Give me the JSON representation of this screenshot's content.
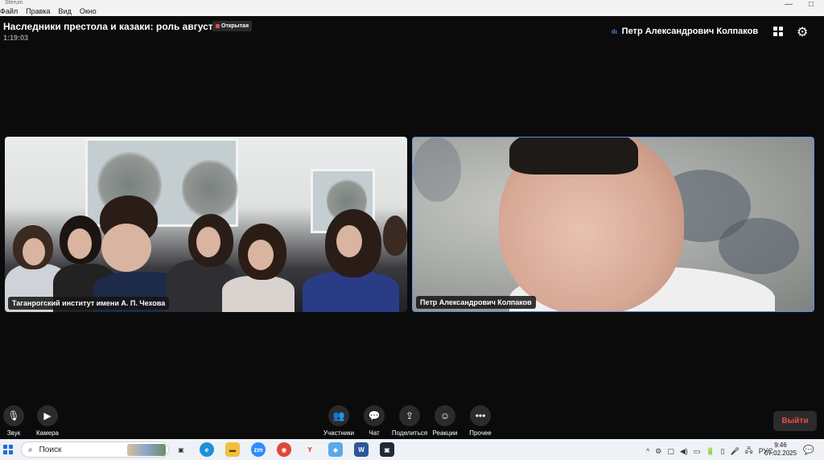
{
  "titlebar": {
    "app_title": "Sferum",
    "menu": [
      "Файл",
      "Правка",
      "Вид",
      "Окно"
    ],
    "minimize_glyph": "—",
    "maximize_glyph": "□"
  },
  "header": {
    "meeting_title": "Наследники престола и казаки: роль августей...",
    "badge": "Открытая",
    "timer": "1:19:03",
    "active_speaker": "Петр Александрович Колпаков",
    "speaker_indicator": "ılı"
  },
  "tiles": [
    {
      "label": "Таганрогский институт имени А. П. Чехова"
    },
    {
      "label": "Петр Александрович Колпаков"
    }
  ],
  "controls": {
    "sound": {
      "label": "Звук",
      "icon": "microphone-icon",
      "glyph": "🎙"
    },
    "camera": {
      "label": "Камера",
      "icon": "video-camera-icon",
      "glyph": "▶"
    },
    "participants": {
      "label": "Участники",
      "icon": "people-icon",
      "glyph": "👥"
    },
    "chat": {
      "label": "Чат",
      "icon": "chat-bubble-icon",
      "glyph": "💬"
    },
    "share": {
      "label": "Поделиться",
      "icon": "share-screen-icon",
      "glyph": "⇪"
    },
    "reactions": {
      "label": "Реакции",
      "icon": "smiley-icon",
      "glyph": "☺"
    },
    "more": {
      "label": "Прочее",
      "icon": "more-dots-icon",
      "glyph": "•••"
    },
    "exit_label": "Выйти"
  },
  "taskbar": {
    "search_label": "Поиск",
    "search_glyph": "⌕",
    "apps": [
      {
        "name": "task-view",
        "glyph": "▣"
      },
      {
        "name": "edge",
        "glyph": "e"
      },
      {
        "name": "file-explorer",
        "glyph": "▬"
      },
      {
        "name": "zoom",
        "glyph": "zm"
      },
      {
        "name": "chrome",
        "glyph": "◉"
      },
      {
        "name": "yandex",
        "glyph": "Y"
      },
      {
        "name": "app-blue",
        "glyph": "◆"
      },
      {
        "name": "word",
        "glyph": "W"
      },
      {
        "name": "app-dark",
        "glyph": "▣"
      }
    ],
    "tray_glyphs": [
      "^",
      "⚙",
      "▢",
      "◀)",
      "▭",
      "🔋",
      "▯",
      "🎤",
      "🖧"
    ],
    "language": "РУС",
    "time": "9:46",
    "date": "07.02.2025",
    "notify_glyph": "💬"
  },
  "colors": {
    "background": "#0b0b0b",
    "accent_blue": "#5b8ee6",
    "exit_red": "#e94a4a",
    "button_bg": "#2b2b2b"
  }
}
